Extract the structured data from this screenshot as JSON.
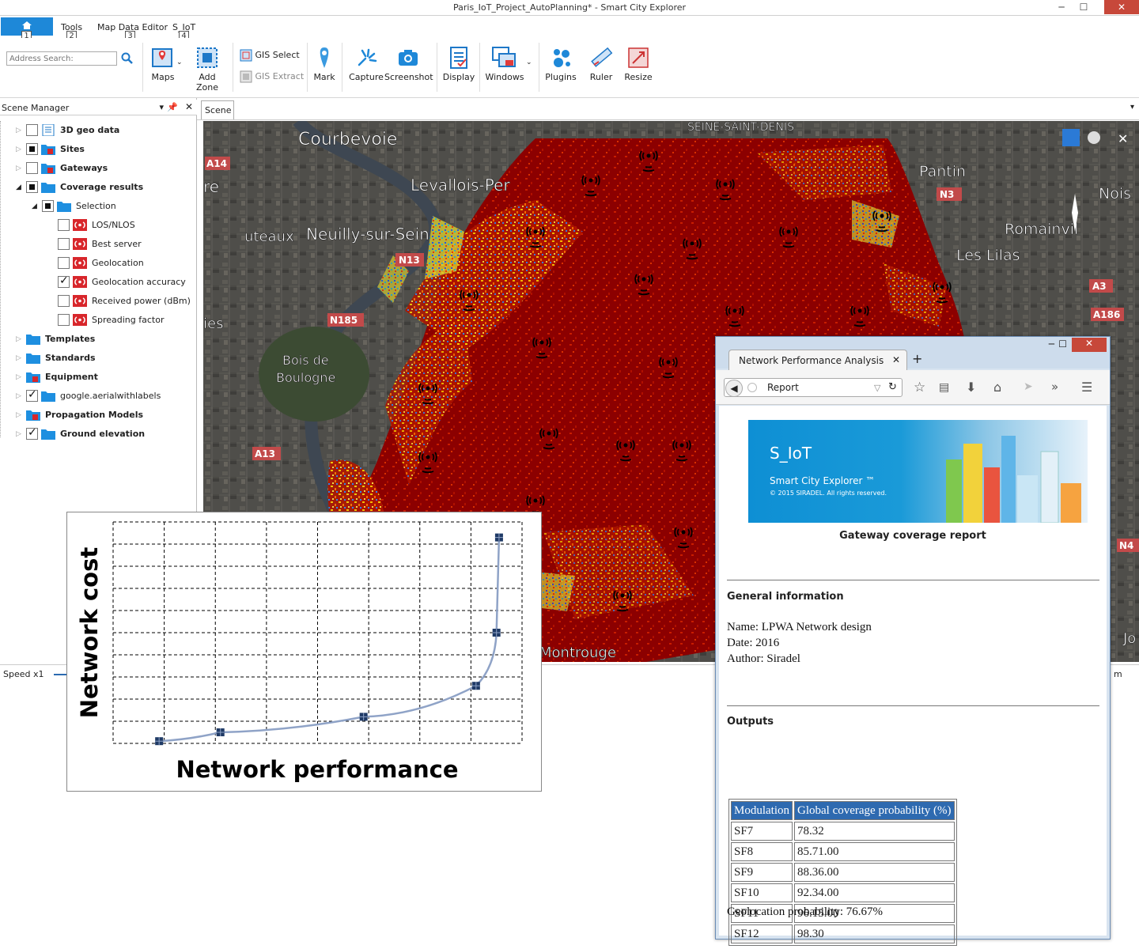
{
  "window": {
    "title": "Paris_IoT_Project_AutoPlanning* - Smart City Explorer",
    "min": "─",
    "max": "☐",
    "close": "✕"
  },
  "menu": {
    "tabs": [
      "Tools",
      "Map Data Editor",
      "S_IoT"
    ],
    "keytips": [
      "1",
      "2",
      "3",
      "4"
    ]
  },
  "ribbon": {
    "search_placeholder": "Address Search:",
    "maps": "Maps",
    "add_zone": "Add Zone",
    "gis_select": "GIS Select",
    "gis_extract": "GIS Extract",
    "mark": "Mark",
    "capture": "Capture",
    "screenshot": "Screenshot",
    "display": "Display",
    "windows": "Windows",
    "plugins": "Plugins",
    "ruler": "Ruler",
    "resize": "Resize"
  },
  "scene_manager": {
    "title": "Scene Manager",
    "items": [
      {
        "label": "3D geo data",
        "check": "off"
      },
      {
        "label": "Sites",
        "check": "partial"
      },
      {
        "label": "Gateways",
        "check": "off"
      },
      {
        "label": "Coverage results",
        "check": "partial"
      },
      {
        "label": "Selection",
        "check": "partial"
      },
      {
        "label": "LOS/NLOS",
        "check": "off"
      },
      {
        "label": "Best server",
        "check": "off"
      },
      {
        "label": "Geolocation",
        "check": "off"
      },
      {
        "label": "Geolocation accuracy",
        "check": "on"
      },
      {
        "label": "Received power (dBm)",
        "check": "off"
      },
      {
        "label": "Spreading factor",
        "check": "off"
      },
      {
        "label": "Templates"
      },
      {
        "label": "Standards"
      },
      {
        "label": "Equipment"
      },
      {
        "label": "google.aerialwithlabels",
        "check": "on"
      },
      {
        "label": "Propagation Models"
      },
      {
        "label": "Ground elevation",
        "check": "on"
      }
    ]
  },
  "scene": {
    "tab": "Scene"
  },
  "map": {
    "labels": {
      "courbevoie": "Courbevoie",
      "levallois": "Levallois-Per",
      "neuilly": "Neuilly-sur-Sein",
      "puteaux": "uteaux",
      "bois": "Bois de",
      "boulogne": "Boulogne",
      "pantin": "Pantin",
      "romainvil": "Romainvil",
      "lilas": "Les Lilas",
      "seine": "SEINE-SAINT-DENIS",
      "noisy": "Nois",
      "montrouge": "Montrouge",
      "ies": "ies",
      "re": "re",
      "jo": "Jo"
    },
    "roads": [
      "A14",
      "N13",
      "N185",
      "A13",
      "N3",
      "A3",
      "A186",
      "N4"
    ]
  },
  "statusbar": {
    "speed": "Speed x1",
    "unit": "m"
  },
  "chart_data": {
    "type": "line",
    "xlabel": "Network performance",
    "ylabel": "Network cost",
    "x": [
      0.9,
      2.1,
      4.9,
      7.1,
      7.5,
      7.55
    ],
    "y": [
      0.1,
      0.5,
      1.2,
      2.6,
      5.0,
      9.3
    ],
    "xlim": [
      0,
      8
    ],
    "ylim": [
      0,
      10
    ],
    "grid": true
  },
  "browser": {
    "tab_title": "Network Performance Analysis",
    "tab_close": "✕",
    "new_tab": "+",
    "url": "Report",
    "banner_title": "S_IoT",
    "banner_sub": "Smart City Explorer ™",
    "banner_copy": "© 2015 SIRADEL. All rights reserved.",
    "report_title": "Gateway coverage report",
    "general_heading": "General information",
    "name_line": "Name: LPWA Network design",
    "date_line": "Date: 2016",
    "author_line": "Author: Siradel",
    "outputs_heading": "Outputs",
    "table_headers": [
      "Modulation",
      "Global coverage probability (%)"
    ],
    "table_rows": [
      [
        "SF7",
        "78.32"
      ],
      [
        "SF8",
        "85.71.00"
      ],
      [
        "SF9",
        "88.36.00"
      ],
      [
        "SF10",
        "92.34.00"
      ],
      [
        "SF11",
        "96.15.00"
      ],
      [
        "SF12",
        "98.30"
      ]
    ],
    "geoloc_line": "Geolocation probability: 76.67%"
  }
}
